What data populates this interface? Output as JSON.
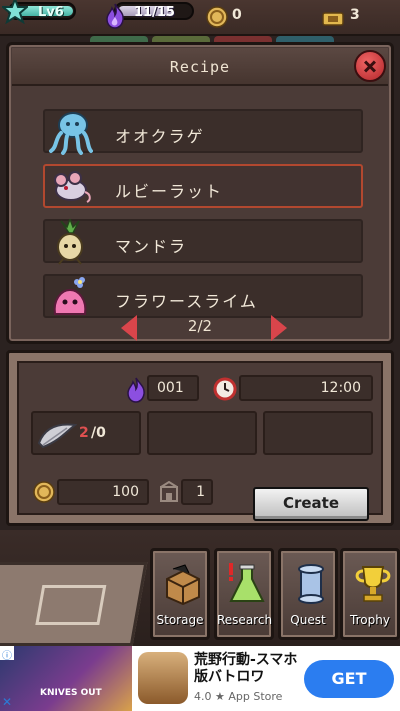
{
  "status": {
    "level_label": "Lv6",
    "level_progress": 0.95,
    "energy_label": "11/15",
    "energy_progress": 0.73,
    "gold": "0",
    "tickets": "3"
  },
  "recipe_panel": {
    "title": "Recipe",
    "items": [
      {
        "name": "オオクラゲ",
        "icon": "jellyfish-icon",
        "selected": false
      },
      {
        "name": "ルビーラット",
        "icon": "rat-icon",
        "selected": true
      },
      {
        "name": "マンドラ",
        "icon": "mandrake-icon",
        "selected": false
      },
      {
        "name": "フラワースライム",
        "icon": "flower-slime-icon",
        "selected": false
      }
    ],
    "page": "2/2"
  },
  "create_panel": {
    "energy_cost": "001",
    "time": "12:00",
    "material_count": "2",
    "material_required": "/0",
    "gold_cost": "100",
    "capacity": "1",
    "create_label": "Create"
  },
  "nav": [
    {
      "label": "Storage",
      "icon": "box-icon"
    },
    {
      "label": "Research",
      "icon": "flask-icon"
    },
    {
      "label": "Quest",
      "icon": "scroll-icon"
    },
    {
      "label": "Trophy",
      "icon": "trophy-icon"
    }
  ],
  "ad": {
    "image_caption": "KNIVES OUT",
    "title": "荒野行動-スマホ版バトロワ",
    "rating": "4.0 ★ App Store",
    "get_label": "GET"
  },
  "colors": {
    "accent_red": "#d9454b",
    "panel_brown": "#4b3b37",
    "ad_blue": "#2b7df0"
  }
}
